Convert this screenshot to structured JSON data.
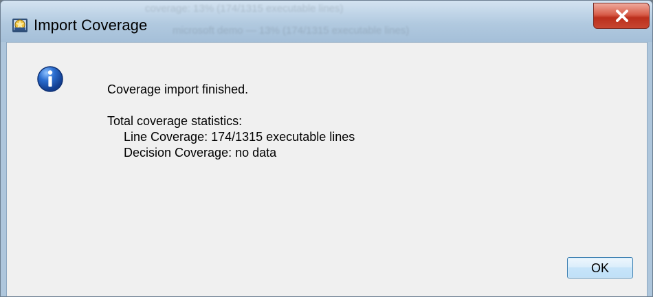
{
  "window": {
    "title": "Import Coverage"
  },
  "background_ghost": {
    "line1": "coverage: 13% (174/1315 executable lines)",
    "line2": "microsoft demo — 13% (174/1315 executable lines)"
  },
  "dialog": {
    "icon": "info-icon",
    "message": "Coverage import finished.",
    "stats_heading": "Total coverage statistics:",
    "line_coverage": "Line Coverage: 174/1315 executable lines",
    "decision_coverage": "Decision Coverage: no data",
    "ok_label": "OK"
  },
  "colors": {
    "title_bar": "#b7cfe3",
    "close_button": "#c74631",
    "content_bg": "#f0f0f0",
    "info_icon": "#1d5fb8"
  }
}
